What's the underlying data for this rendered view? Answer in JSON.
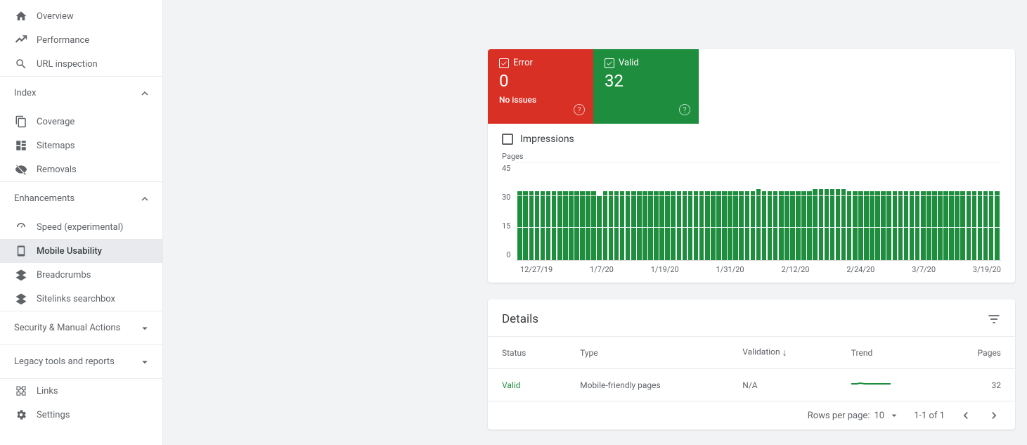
{
  "sidebar": {
    "top": [
      {
        "label": "Overview",
        "name": "sidebar-item-overview"
      },
      {
        "label": "Performance",
        "name": "sidebar-item-performance"
      },
      {
        "label": "URL inspection",
        "name": "sidebar-item-url-inspection"
      }
    ],
    "sections": [
      {
        "title": "Index",
        "expanded": true,
        "name": "sidebar-section-index",
        "items": [
          {
            "label": "Coverage",
            "name": "sidebar-item-coverage"
          },
          {
            "label": "Sitemaps",
            "name": "sidebar-item-sitemaps"
          },
          {
            "label": "Removals",
            "name": "sidebar-item-removals"
          }
        ]
      },
      {
        "title": "Enhancements",
        "expanded": true,
        "name": "sidebar-section-enhancements",
        "items": [
          {
            "label": "Speed (experimental)",
            "name": "sidebar-item-speed"
          },
          {
            "label": "Mobile Usability",
            "name": "sidebar-item-mobile-usability",
            "active": true
          },
          {
            "label": "Breadcrumbs",
            "name": "sidebar-item-breadcrumbs"
          },
          {
            "label": "Sitelinks searchbox",
            "name": "sidebar-item-sitelinks-searchbox"
          }
        ]
      },
      {
        "title": "Security & Manual Actions",
        "expanded": false,
        "name": "sidebar-section-security",
        "items": []
      },
      {
        "title": "Legacy tools and reports",
        "expanded": false,
        "name": "sidebar-section-legacy",
        "items": []
      }
    ],
    "bottom": [
      {
        "label": "Links",
        "name": "sidebar-item-links"
      },
      {
        "label": "Settings",
        "name": "sidebar-item-settings"
      }
    ]
  },
  "summary": {
    "error": {
      "label": "Error",
      "count": "0",
      "sub": "No issues"
    },
    "valid": {
      "label": "Valid",
      "count": "32"
    },
    "impressions_label": "Impressions"
  },
  "chart_data": {
    "type": "bar",
    "title": "Pages",
    "ylabel": "Pages",
    "ylim": [
      0,
      45
    ],
    "yticks": [
      45,
      30,
      15,
      0
    ],
    "xticks": [
      "12/27/19",
      "1/7/20",
      "1/19/20",
      "1/31/20",
      "2/12/20",
      "2/24/20",
      "3/7/20",
      "3/19/20"
    ],
    "values": [
      32,
      32,
      32,
      32,
      32,
      32,
      32,
      32,
      32,
      32,
      32,
      32,
      32,
      32,
      30,
      32,
      32,
      32,
      32,
      32,
      32,
      32,
      32,
      32,
      32,
      32,
      32,
      32,
      32,
      32,
      32,
      32,
      32,
      32,
      32,
      32,
      32,
      32,
      32,
      32,
      32,
      32,
      33,
      32,
      32,
      32,
      32,
      32,
      32,
      32,
      32,
      32,
      33,
      33,
      33,
      33,
      33,
      33,
      32,
      32,
      32,
      32,
      32,
      32,
      32,
      32,
      32,
      32,
      32,
      32,
      32,
      32,
      32,
      32,
      32,
      32,
      32,
      32,
      32,
      32,
      32,
      32,
      32,
      32,
      32
    ]
  },
  "details": {
    "title": "Details",
    "columns": {
      "status": "Status",
      "type": "Type",
      "validation": "Validation",
      "trend": "Trend",
      "pages": "Pages"
    },
    "rows": [
      {
        "status": "Valid",
        "type": "Mobile-friendly pages",
        "validation": "N/A",
        "pages": "32"
      }
    ],
    "pager": {
      "rows_label": "Rows per page:",
      "rows_value": "10",
      "range": "1-1 of 1"
    }
  }
}
